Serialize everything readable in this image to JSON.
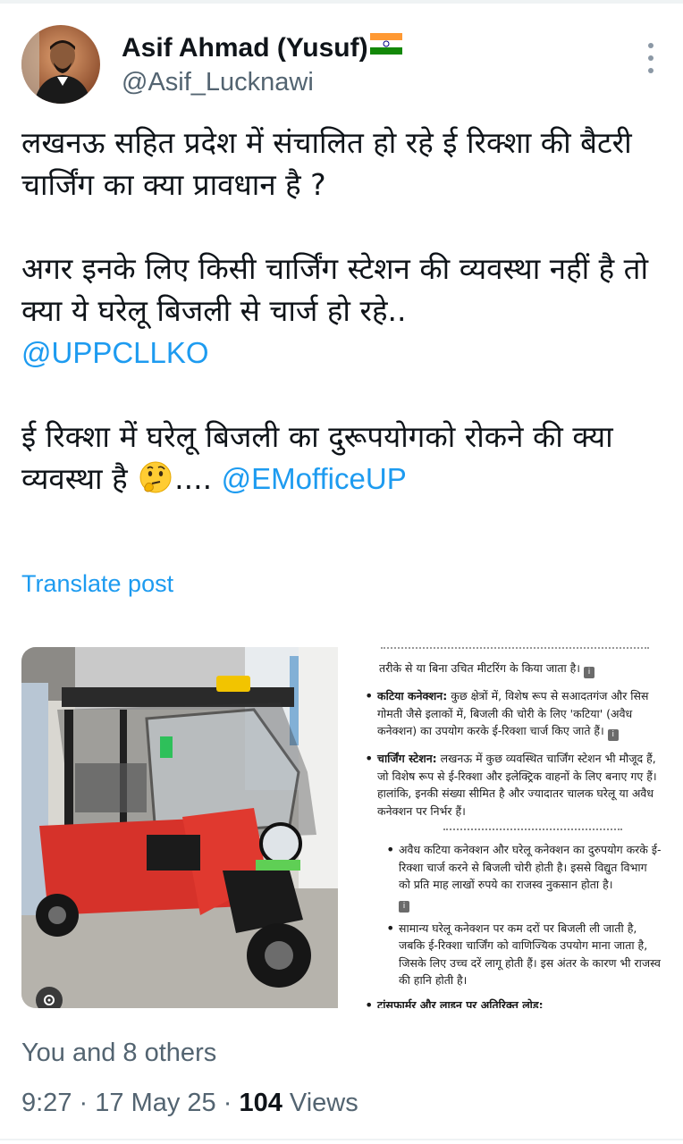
{
  "post": {
    "author": {
      "display_name": "Asif Ahmad (Yusuf)",
      "handle": "@Asif_Lucknawi",
      "flag_icon": "india-flag-icon"
    },
    "text": {
      "line1": "लखनऊ सहित प्रदेश में संचालित हो रहे ई रिक्शा की बैटरी चार्जिंग का क्या प्रावधान है ?",
      "line2": "अगर इनके लिए किसी चार्जिंग स्टेशन की व्यवस्था नहीं है तो क्या ये घरेलू बिजली से चार्ज हो रहे..",
      "mention1": "@UPPCLLKO",
      "line3": "ई रिक्शा में घरेलू बिजली का दुरूपयोगको रोकने की क्या व्यवस्था है",
      "emoji": "thinking-face-icon",
      "ellipsis": "....",
      "mention2": "@EMofficeUP"
    },
    "translate_label": "Translate post",
    "likes_text": "You and 8 others",
    "time": "9:27",
    "date": "17 May 25",
    "views_count": "104",
    "views_label": "Views",
    "separator": "·"
  },
  "doc_image": {
    "top_fragment": "तरीके से या बिना उचित मीटरिंग के किया जाता है।",
    "bullet1_title": "कटिया कनेक्शन:",
    "bullet1_text": "कुछ क्षेत्रों में, विशेष रूप से सआदतगंज और सिस गोमती जैसे इलाकों में, बिजली की चोरी के लिए 'कटिया' (अवैध कनेक्शन) का उपयोग करके ई-रिक्शा चार्ज किए जाते हैं।",
    "bullet2_title": "चार्जिंग स्टेशन:",
    "bullet2_text": "लखनऊ में कुछ व्यवस्थित चार्जिंग स्टेशन भी मौजूद हैं, जो विशेष रूप से ई-रिक्शा और इलेक्ट्रिक वाहनों के लिए बनाए गए हैं। हालांकि, इनकी संख्या सीमित है और ज्यादातर चालक घरेलू या अवैध कनेक्शन पर निर्भर हैं।",
    "sub1": "अवैध कटिया कनेक्शन और घरेलू कनेक्शन का दुरुपयोग करके ई-रिक्शा चार्ज करने से बिजली चोरी होती है। इससे विद्युत विभाग को प्रति माह लाखों रुपये का राजस्व नुकसान होता है।",
    "sub2": "सामान्य घरेलू कनेक्शन पर कम दरों पर बिजली ली जाती है, जबकि ई-रिक्शा चार्जिंग को वाणिज्यिक उपयोग माना जाता है, जिसके लिए उच्च दरें लागू होती हैं। इस अंतर के कारण भी राजस्व की हानि होती है।",
    "bullet3_title": "ट्रांसफार्मर और लाइन पर अतिरिक्त लोड:"
  },
  "colors": {
    "link": "#1d9bf0",
    "secondary_text": "#536471",
    "primary_text": "#0f1419"
  }
}
